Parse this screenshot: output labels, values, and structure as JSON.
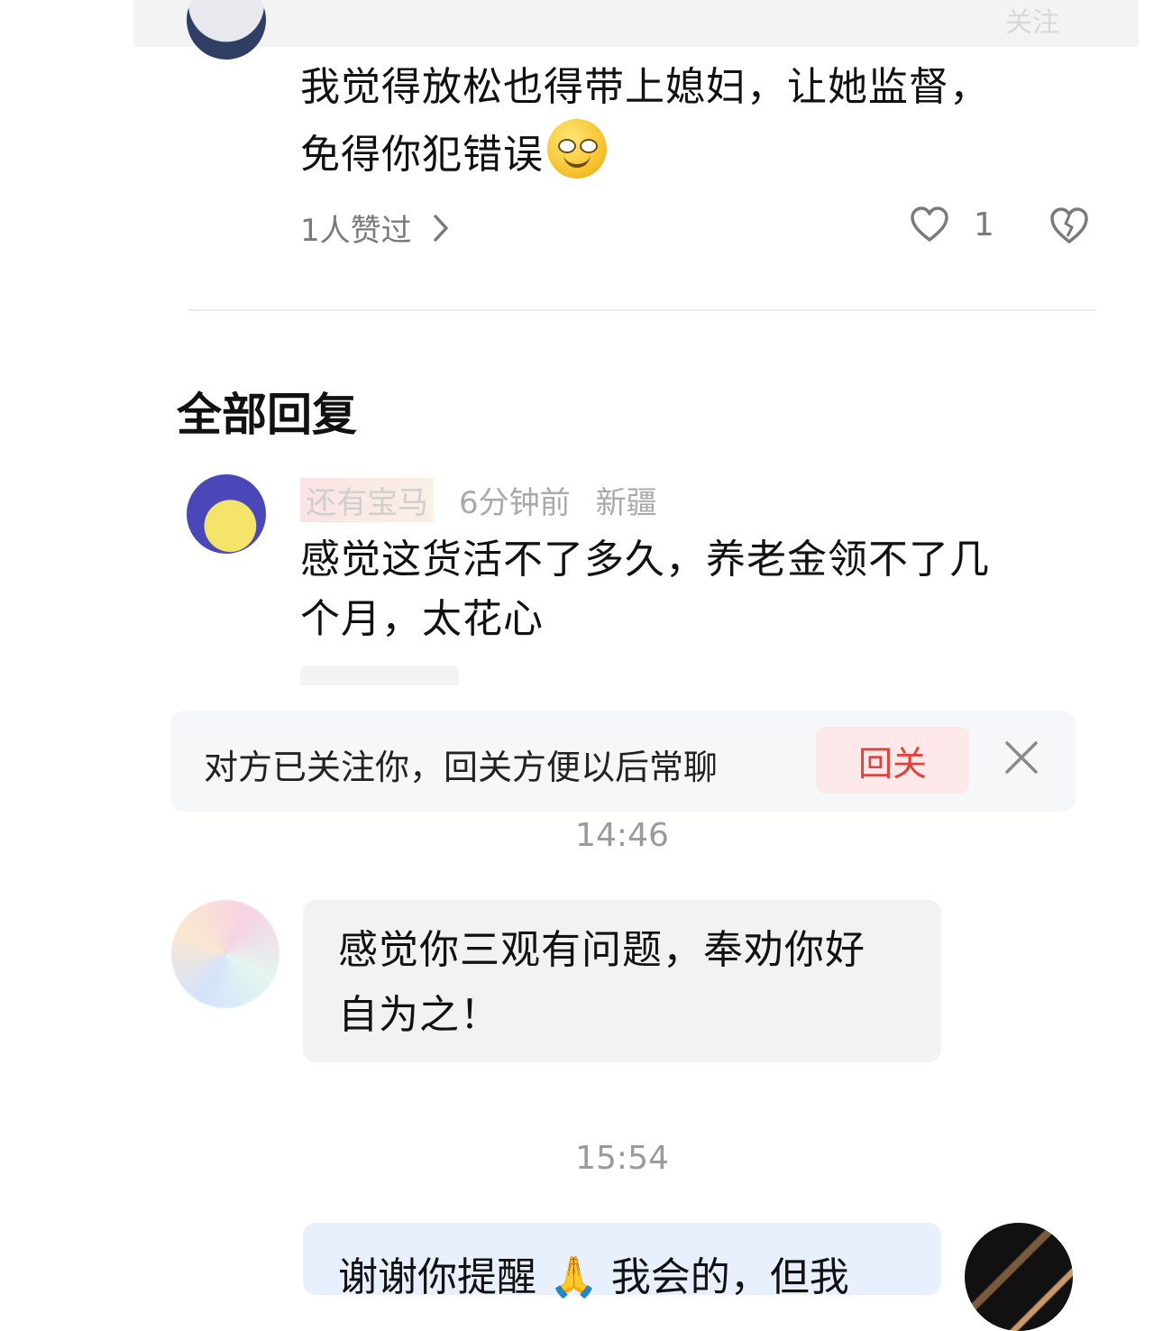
{
  "header": {
    "follow_label": "关注"
  },
  "main_comment": {
    "text_line1": "我觉得放松也得带上媳妇，让她监督，",
    "text_line2": "免得你犯错误",
    "liked_by": "1人赞过",
    "like_count": "1"
  },
  "replies_section": {
    "title": "全部回复",
    "reply": {
      "username": "还有宝马",
      "time_ago": "6分钟前",
      "location": "新疆",
      "text_line1": "感觉这货活不了多久，养老金领不了几",
      "text_line2": "个月，太花心"
    }
  },
  "notification": {
    "text": "对方已关注你，回关方便以后常聊",
    "button_label": "回关"
  },
  "chat": {
    "time1": "14:46",
    "message1_line1": "感觉你三观有问题，奉劝你好",
    "message1_line2": "自为之！",
    "time2": "15:54",
    "message2": "谢谢你提醒 🙏 我会的，但我"
  },
  "colors": {
    "accent_red": "#e0433b",
    "follow_btn_bg": "#fde9e9",
    "outgoing_bubble": "#e8f0fd",
    "incoming_bubble": "#f2f2f2"
  }
}
